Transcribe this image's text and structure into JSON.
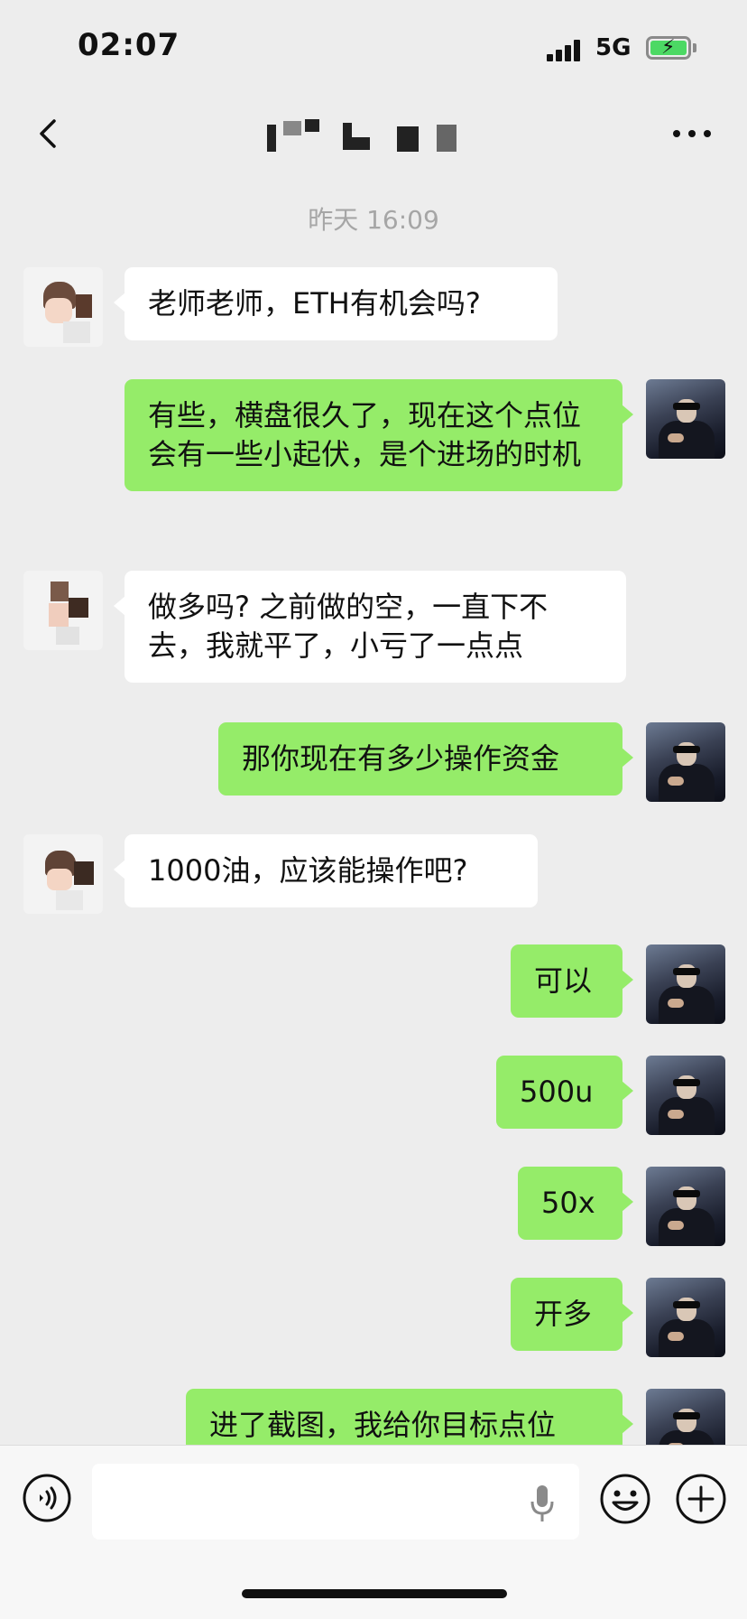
{
  "status_bar": {
    "time": "02:07",
    "network": "5G",
    "icons": [
      "signal-icon",
      "battery-charging-icon"
    ]
  },
  "header": {
    "icons": [
      "back-icon",
      "more-icon"
    ]
  },
  "timestamp": "昨天 16:09",
  "messages": [
    {
      "side": "left",
      "text": "老师老师，ETH有机会吗?"
    },
    {
      "side": "right",
      "text": "有些，横盘很久了，现在这个点位会有一些小起伏，是个进场的时机"
    },
    {
      "side": "left",
      "text": "做多吗? 之前做的空，一直下不去，我就平了，小亏了一点点"
    },
    {
      "side": "right",
      "text": "那你现在有多少操作资金"
    },
    {
      "side": "left",
      "text": "1000油，应该能操作吧?"
    },
    {
      "side": "right",
      "text": "可以"
    },
    {
      "side": "right",
      "text": "500u"
    },
    {
      "side": "right",
      "text": "50x"
    },
    {
      "side": "right",
      "text": "开多"
    },
    {
      "side": "right",
      "text": "进了截图，我给你目标点位"
    }
  ],
  "input_bar": {
    "value": "",
    "icons": [
      "voice-icon",
      "microphone-icon",
      "emoji-icon",
      "plus-icon"
    ]
  },
  "colors": {
    "background": "#ededed",
    "sent_bubble": "#95ec69",
    "received_bubble": "#ffffff",
    "timestamp": "#a6a6a6"
  }
}
